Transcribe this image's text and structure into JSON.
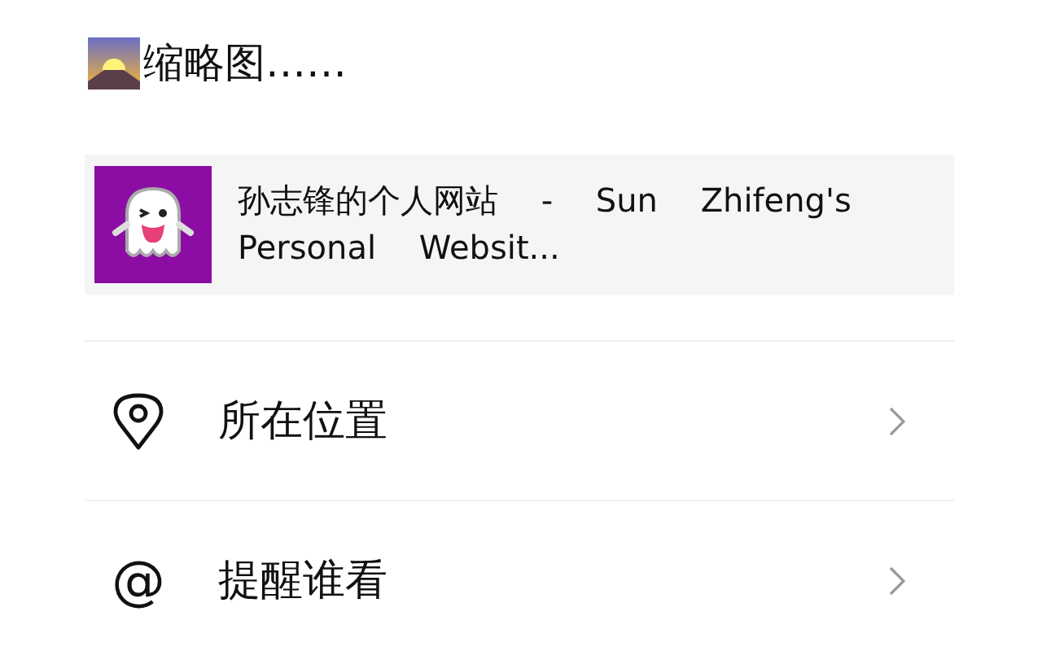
{
  "header": {
    "title": "缩略图……"
  },
  "link_card": {
    "title": "孙志锋的个人网站 - Sun Zhifeng's Personal Websit..."
  },
  "options": [
    {
      "kind": "location",
      "label": "所在位置"
    },
    {
      "kind": "mention",
      "icon": "@",
      "label": "提醒谁看"
    }
  ]
}
